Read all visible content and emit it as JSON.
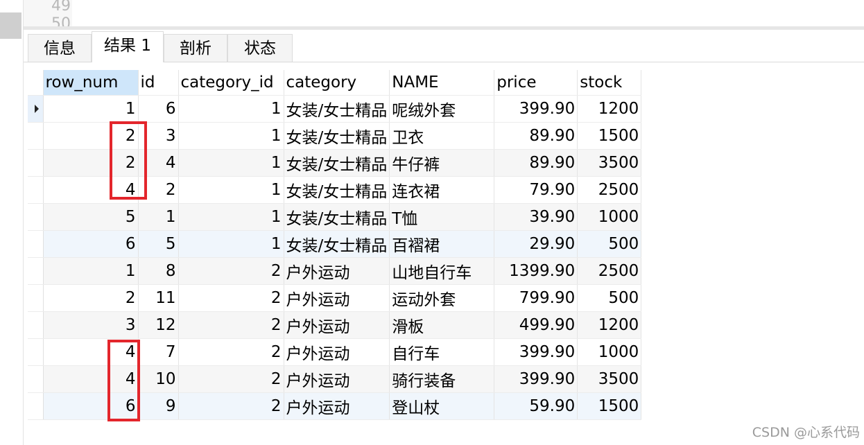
{
  "editor": {
    "line_numbers": [
      "49",
      "50"
    ]
  },
  "tabs": [
    {
      "label": "信息",
      "active": false
    },
    {
      "label": "结果 1",
      "active": true
    },
    {
      "label": "剖析",
      "active": false
    },
    {
      "label": "状态",
      "active": false
    }
  ],
  "grid": {
    "columns": [
      "row_num",
      "id",
      "category_id",
      "category",
      "NAME",
      "price",
      "stock"
    ],
    "rows": [
      [
        "1",
        "6",
        "1",
        "女装/女士精品",
        "呢绒外套",
        "399.90",
        "1200"
      ],
      [
        "2",
        "3",
        "1",
        "女装/女士精品",
        "卫衣",
        "89.90",
        "1500"
      ],
      [
        "2",
        "4",
        "1",
        "女装/女士精品",
        "牛仔裤",
        "89.90",
        "3500"
      ],
      [
        "4",
        "2",
        "1",
        "女装/女士精品",
        "连衣裙",
        "79.90",
        "2500"
      ],
      [
        "5",
        "1",
        "1",
        "女装/女士精品",
        "T恤",
        "39.90",
        "1000"
      ],
      [
        "6",
        "5",
        "1",
        "女装/女士精品",
        "百褶裙",
        "29.90",
        "500"
      ],
      [
        "1",
        "8",
        "2",
        "户外运动",
        "山地自行车",
        "1399.90",
        "2500"
      ],
      [
        "2",
        "11",
        "2",
        "户外运动",
        "运动外套",
        "799.90",
        "500"
      ],
      [
        "3",
        "12",
        "2",
        "户外运动",
        "滑板",
        "499.90",
        "1200"
      ],
      [
        "4",
        "7",
        "2",
        "户外运动",
        "自行车",
        "399.90",
        "1000"
      ],
      [
        "4",
        "10",
        "2",
        "户外运动",
        "骑行装备",
        "399.90",
        "3500"
      ],
      [
        "6",
        "9",
        "2",
        "户外运动",
        "登山杖",
        "59.90",
        "1500"
      ]
    ]
  },
  "colors": {
    "highlight_box": "#e3262c",
    "sorted_header": "#cfe6fa"
  },
  "watermark": "CSDN @心系代码"
}
